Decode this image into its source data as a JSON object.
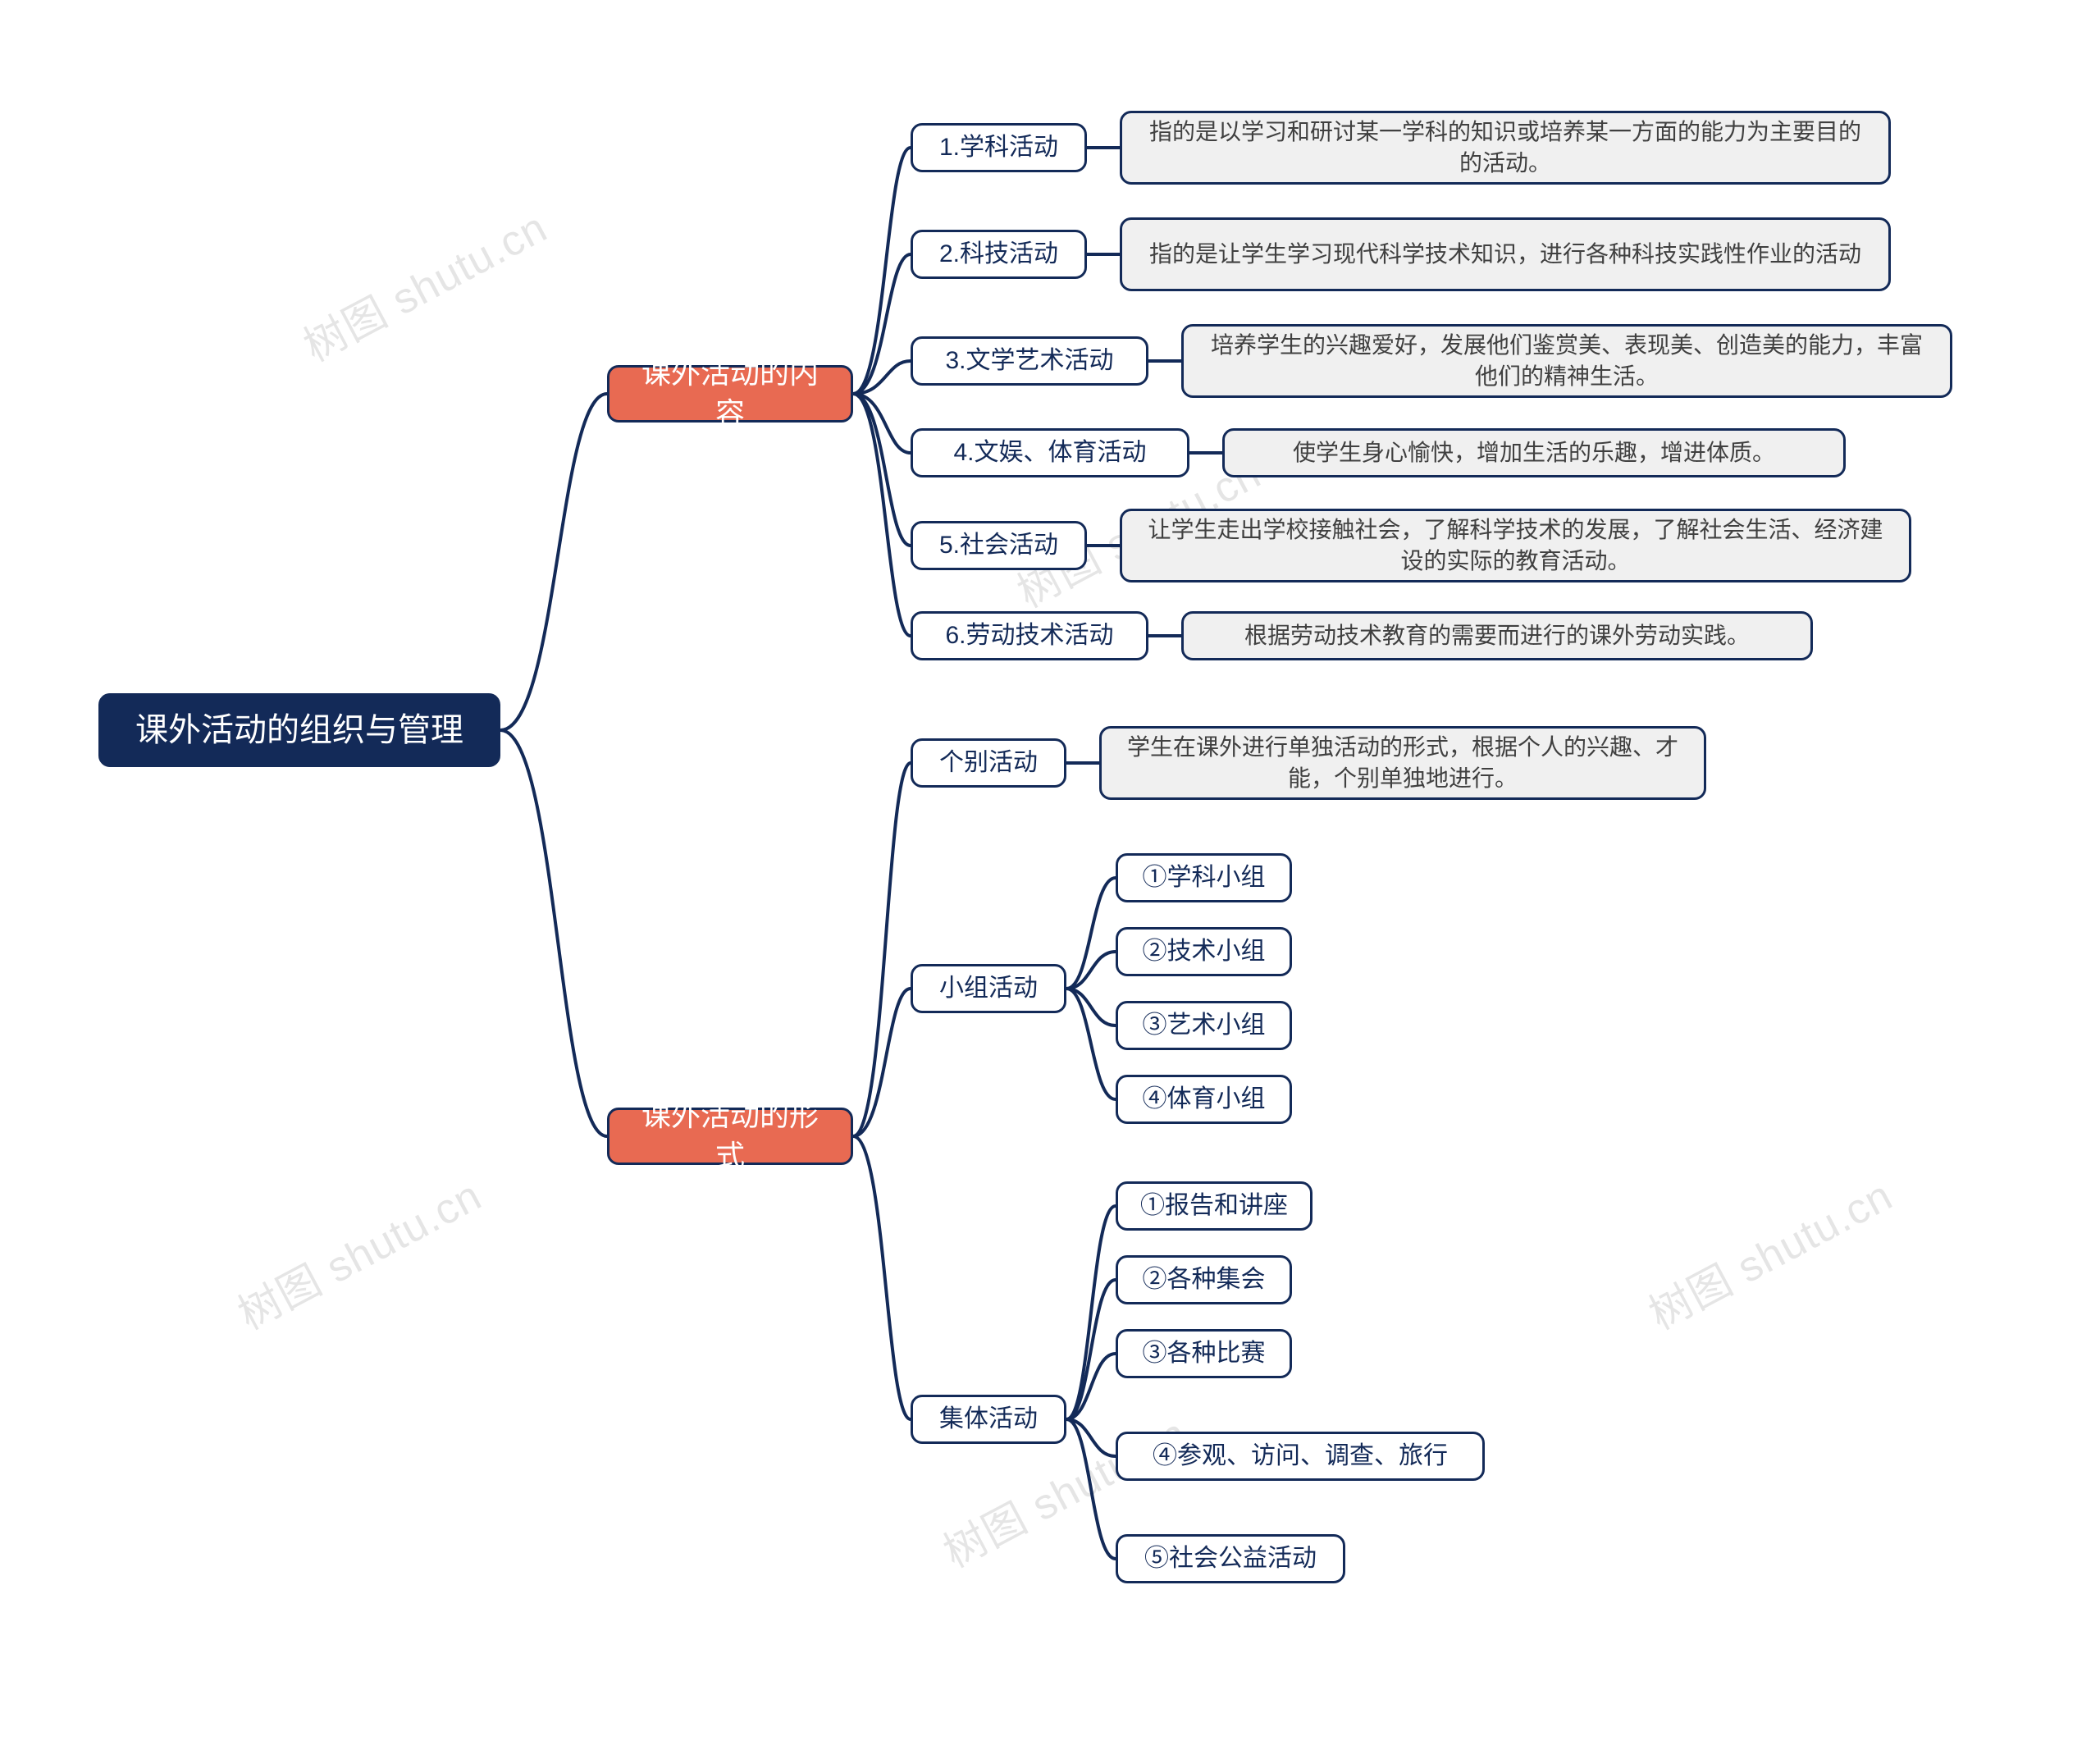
{
  "watermark": "树图 shutu.cn",
  "root": {
    "label": "课外活动的组织与管理"
  },
  "level1": {
    "content": {
      "label": "课外活动的内容"
    },
    "form": {
      "label": "课外活动的形式"
    }
  },
  "content_items": {
    "i1": {
      "label": "1.学科活动",
      "desc": "指的是以学习和研讨某一学科的知识或培养某一方面的能力为主要目的的活动。"
    },
    "i2": {
      "label": "2.科技活动",
      "desc": "指的是让学生学习现代科学技术知识，进行各种科技实践性作业的活动"
    },
    "i3": {
      "label": "3.文学艺术活动",
      "desc": "培养学生的兴趣爱好，发展他们鉴赏美、表现美、创造美的能力，丰富他们的精神生活。"
    },
    "i4": {
      "label": "4.文娱、体育活动",
      "desc": "使学生身心愉快，增加生活的乐趣，增进体质。"
    },
    "i5": {
      "label": "5.社会活动",
      "desc": "让学生走出学校接触社会，了解科学技术的发展，了解社会生活、经济建设的实际的教育活动。"
    },
    "i6": {
      "label": "6.劳动技术活动",
      "desc": "根据劳动技术教育的需要而进行的课外劳动实践。"
    }
  },
  "form_items": {
    "individual": {
      "label": "个别活动",
      "desc": "学生在课外进行单独活动的形式，根据个人的兴趣、才能，个别单独地进行。"
    },
    "group": {
      "label": "小组活动",
      "sub": {
        "s1": "①学科小组",
        "s2": "②技术小组",
        "s3": "③艺术小组",
        "s4": "④体育小组"
      }
    },
    "collective": {
      "label": "集体活动",
      "sub": {
        "c1": "①报告和讲座",
        "c2": "②各种集会",
        "c3": "③各种比赛",
        "c4": "④参观、访问、调查、旅行",
        "c5": "⑤社会公益活动"
      }
    }
  },
  "colors": {
    "root_bg": "#132a58",
    "lvl1_bg": "#e86a52",
    "border": "#132a58",
    "lvl3_bg": "#f0f0f0"
  },
  "chart_data": {
    "type": "mindmap",
    "title": "课外活动的组织与管理",
    "nodes": [
      {
        "id": "root",
        "label": "课外活动的组织与管理",
        "level": 0
      },
      {
        "id": "b1",
        "parent": "root",
        "label": "课外活动的内容",
        "level": 1
      },
      {
        "id": "b2",
        "parent": "root",
        "label": "课外活动的形式",
        "level": 1
      },
      {
        "id": "c1",
        "parent": "b1",
        "label": "1.学科活动",
        "level": 2
      },
      {
        "id": "c2",
        "parent": "b1",
        "label": "2.科技活动",
        "level": 2
      },
      {
        "id": "c3",
        "parent": "b1",
        "label": "3.文学艺术活动",
        "level": 2
      },
      {
        "id": "c4",
        "parent": "b1",
        "label": "4.文娱、体育活动",
        "level": 2
      },
      {
        "id": "c5",
        "parent": "b1",
        "label": "5.社会活动",
        "level": 2
      },
      {
        "id": "c6",
        "parent": "b1",
        "label": "6.劳动技术活动",
        "level": 2
      },
      {
        "id": "c1d",
        "parent": "c1",
        "label": "指的是以学习和研讨某一学科的知识或培养某一方面的能力为主要目的的活动。",
        "level": 3
      },
      {
        "id": "c2d",
        "parent": "c2",
        "label": "指的是让学生学习现代科学技术知识，进行各种科技实践性作业的活动",
        "level": 3
      },
      {
        "id": "c3d",
        "parent": "c3",
        "label": "培养学生的兴趣爱好，发展他们鉴赏美、表现美、创造美的能力，丰富他们的精神生活。",
        "level": 3
      },
      {
        "id": "c4d",
        "parent": "c4",
        "label": "使学生身心愉快，增加生活的乐趣，增进体质。",
        "level": 3
      },
      {
        "id": "c5d",
        "parent": "c5",
        "label": "让学生走出学校接触社会，了解科学技术的发展，了解社会生活、经济建设的实际的教育活动。",
        "level": 3
      },
      {
        "id": "c6d",
        "parent": "c6",
        "label": "根据劳动技术教育的需要而进行的课外劳动实践。",
        "level": 3
      },
      {
        "id": "f1",
        "parent": "b2",
        "label": "个别活动",
        "level": 2
      },
      {
        "id": "f2",
        "parent": "b2",
        "label": "小组活动",
        "level": 2
      },
      {
        "id": "f3",
        "parent": "b2",
        "label": "集体活动",
        "level": 2
      },
      {
        "id": "f1d",
        "parent": "f1",
        "label": "学生在课外进行单独活动的形式，根据个人的兴趣、才能，个别单独地进行。",
        "level": 3
      },
      {
        "id": "g1",
        "parent": "f2",
        "label": "①学科小组",
        "level": 3
      },
      {
        "id": "g2",
        "parent": "f2",
        "label": "②技术小组",
        "level": 3
      },
      {
        "id": "g3",
        "parent": "f2",
        "label": "③艺术小组",
        "level": 3
      },
      {
        "id": "g4",
        "parent": "f2",
        "label": "④体育小组",
        "level": 3
      },
      {
        "id": "h1",
        "parent": "f3",
        "label": "①报告和讲座",
        "level": 3
      },
      {
        "id": "h2",
        "parent": "f3",
        "label": "②各种集会",
        "level": 3
      },
      {
        "id": "h3",
        "parent": "f3",
        "label": "③各种比赛",
        "level": 3
      },
      {
        "id": "h4",
        "parent": "f3",
        "label": "④参观、访问、调查、旅行",
        "level": 3
      },
      {
        "id": "h5",
        "parent": "f3",
        "label": "⑤社会公益活动",
        "level": 3
      }
    ]
  }
}
